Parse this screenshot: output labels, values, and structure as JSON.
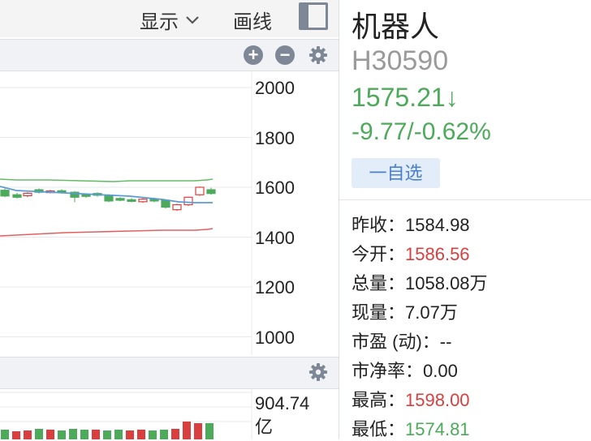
{
  "toolbar": {
    "display_label": "显示",
    "draw_label": "画线"
  },
  "price_axis": {
    "ticks": [
      "2000",
      "1800",
      "1600",
      "1400",
      "1200",
      "1000"
    ]
  },
  "volume": {
    "value": "904.74",
    "unit": "亿"
  },
  "colors": {
    "up": "#d93f3f",
    "down": "#4caa5a",
    "ma_line": "#5b9bd5",
    "upper_band": "#66bb66",
    "lower_band": "#e06060",
    "accent": "#4a7fd0"
  },
  "stock": {
    "name": "机器人",
    "code": "H30590",
    "price": "1575.21↓",
    "change": "-9.77/-0.62%",
    "watchlist_label": "一自选"
  },
  "stats": [
    {
      "label": "昨收：",
      "value": "1584.98",
      "trend": "flat"
    },
    {
      "label": "今开：",
      "value": "1586.56",
      "trend": "up"
    },
    {
      "label": "总量：",
      "value": "1058.08万",
      "trend": "flat"
    },
    {
      "label": "现量：",
      "value": "7.07万",
      "trend": "flat"
    },
    {
      "label": "市盈 (动)：",
      "value": "--",
      "trend": "flat"
    },
    {
      "label": "市净率：",
      "value": "0.00",
      "trend": "flat"
    },
    {
      "label": "最高：",
      "value": "1598.00",
      "trend": "up"
    },
    {
      "label": "最低：",
      "value": "1574.81",
      "trend": "down"
    }
  ]
}
